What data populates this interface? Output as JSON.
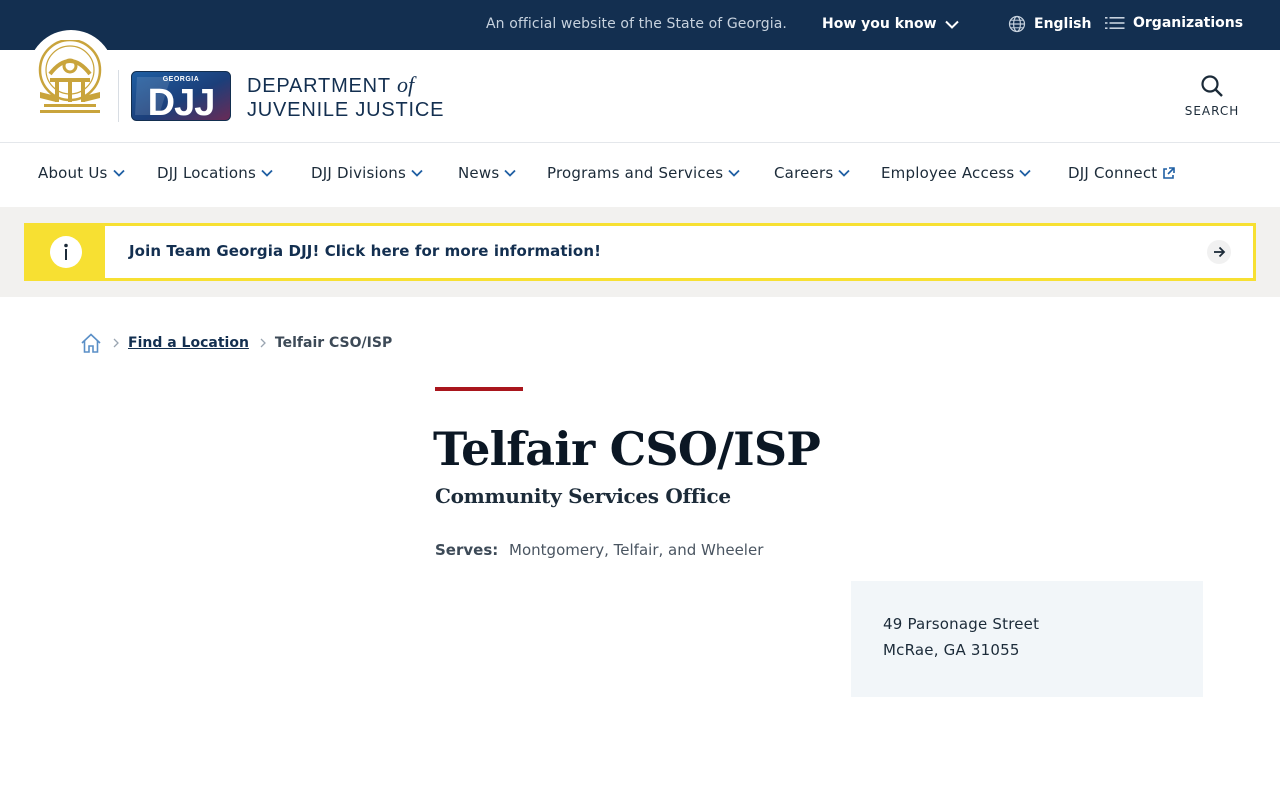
{
  "topbar": {
    "official_text": "An official website of the State of Georgia.",
    "how_you_know": "How you know",
    "language": "English",
    "organizations": "Organizations"
  },
  "header": {
    "logo_text": "DJJ",
    "logo_state": "GEORGIA",
    "dept_line1_prefix": "DEPARTMENT",
    "dept_line1_of": "of",
    "dept_line2": "JUVENILE JUSTICE",
    "search_label": "SEARCH"
  },
  "nav": {
    "items": [
      {
        "label": "About Us"
      },
      {
        "label": "DJJ Locations"
      },
      {
        "label": "DJJ Divisions"
      },
      {
        "label": "News"
      },
      {
        "label": "Programs and Services"
      },
      {
        "label": "Careers"
      },
      {
        "label": "Employee Access"
      },
      {
        "label": "DJJ Connect"
      }
    ]
  },
  "alert": {
    "text": "Join Team Georgia DJJ! Click here for more information!"
  },
  "breadcrumb": {
    "link": "Find a Location",
    "current": "Telfair CSO/ISP"
  },
  "page": {
    "title": "Telfair CSO/ISP",
    "subtitle": "Community Services Office",
    "serves_label": "Serves:",
    "serves_value": "Montgomery, Telfair, and Wheeler",
    "address_line1": "49 Parsonage Street",
    "address_line2": "McRae, GA 31055"
  },
  "colors": {
    "navy": "#132f50",
    "gold": "#c9a43c",
    "alert_yellow": "#f7e032",
    "accent_red": "#a9161d",
    "card_bg": "#f2f6f9"
  },
  "icons": {
    "chevron": "chevron-down-icon",
    "globe": "globe-icon",
    "list": "list-icon",
    "search": "search-icon",
    "info": "info-icon",
    "arrow": "arrow-right-icon",
    "home": "home-icon",
    "external": "external-link-icon"
  }
}
